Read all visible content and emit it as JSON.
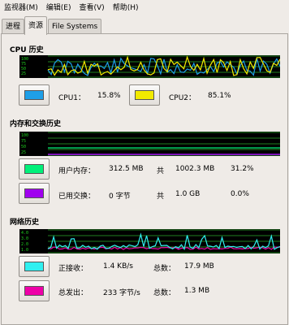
{
  "menu": [
    "监视器(M)",
    "编辑(E)",
    "查看(V)",
    "帮助(H)"
  ],
  "tabs": [
    "进程",
    "资源",
    "File Systems"
  ],
  "active_tab": 1,
  "cpu": {
    "title": "CPU 历史",
    "cpu1_label": "CPU1：",
    "cpu1_value": "15.8%",
    "cpu1_color": "#1e9fe8",
    "cpu2_label": "CPU2：",
    "cpu2_value": "85.1%",
    "cpu2_color": "#f2ea00"
  },
  "memory": {
    "title": "内存和交换历史",
    "mem_label": "用户内存：",
    "mem_used": "312.5 MB",
    "mem_of": "共",
    "mem_total": "1002.3 MB",
    "mem_percent": "31.2%",
    "mem_color": "#00f07a",
    "swap_label": "已用交换：",
    "swap_used": "0 字节",
    "swap_of": "共",
    "swap_total": "1.0 GB",
    "swap_percent": "0.0%",
    "swap_color": "#a000ef"
  },
  "network": {
    "title": "网络历史",
    "recv_label": "正接收：",
    "recv_rate": "1.4 KB/s",
    "recv_total_label": "总数：",
    "recv_total": "17.9 MB",
    "recv_color": "#30f0f0",
    "send_label": "总发出：",
    "send_rate": "233 字节/s",
    "send_total_label": "总数：",
    "send_total": "1.3 MB",
    "send_color": "#ee00a8"
  }
}
